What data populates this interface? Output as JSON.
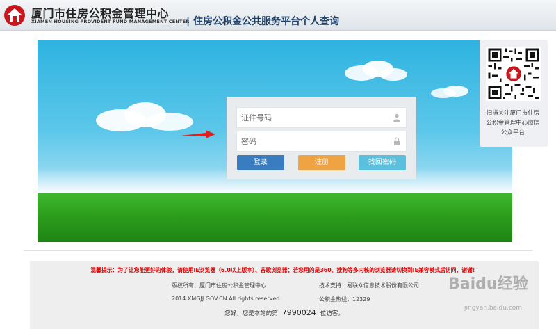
{
  "header": {
    "logo_cn": "厦门市住房公积金管理中心",
    "logo_en": "XIAMEN HOUSING PROVIDENT FUND MANAGEMENT CENTER",
    "separator": "|",
    "title": "住房公积金公共服务平台个人查询"
  },
  "login": {
    "id_placeholder": "证件号码",
    "password_placeholder": "密码",
    "login_label": "登录",
    "register_label": "注册",
    "forgot_label": "找回密码"
  },
  "qr": {
    "caption": "扫描关注厦门市住房公积金管理中心微信公众平台"
  },
  "footer": {
    "notice": "温馨提示：为了让您能更好的体验，请使用IE浏览器（6.0以上版本）、谷歌浏览器；若您用的是360、搜狗等多内核的浏览器请切换到IE兼容模式后访问，谢谢！",
    "copyright": "版权所有：厦门市住房公积金管理中心",
    "tech_support": "技术支持：易联众信息技术股份有限公司",
    "site_line": "2014 XMGJJ.GOV.CN All rights reserved",
    "hotline": "公积金热线：12329",
    "visits_prefix": "您好，您是本站的第",
    "visits_count": "7990024",
    "visits_suffix": "位访客。"
  },
  "watermark": {
    "brand": "Baidu经验",
    "url": "jingyan.baidu.com"
  },
  "colors": {
    "login": "#3a7cc0",
    "register": "#efa342",
    "forgot": "#5bc0de",
    "notice": "#e00000"
  },
  "icons": {
    "user": "user-icon",
    "lock": "lock-icon",
    "logo": "house-logo-icon",
    "arrow": "arrow-right-icon"
  }
}
